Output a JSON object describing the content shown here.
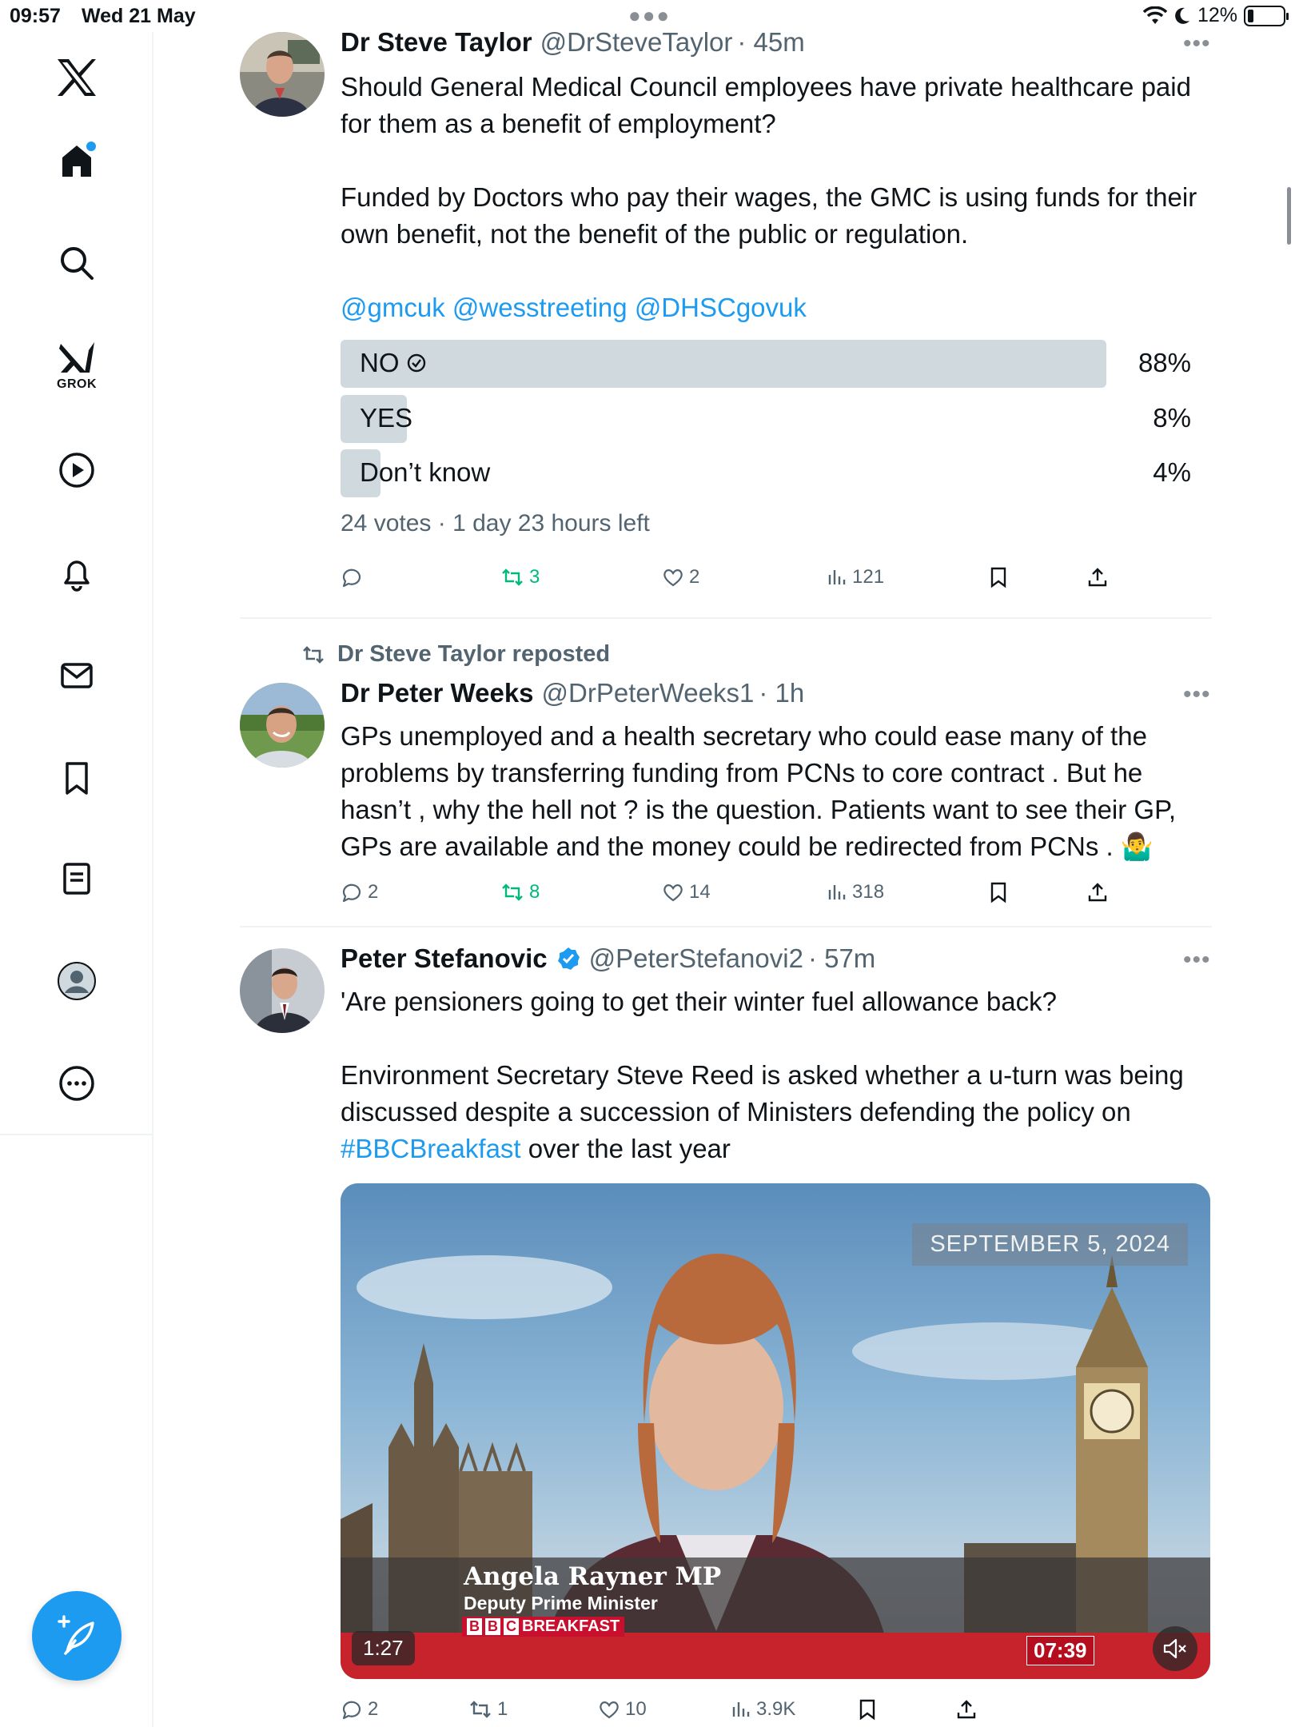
{
  "status_bar": {
    "time": "09:57",
    "date": "Wed 21 May",
    "battery": "12%"
  },
  "sidebar": {
    "items": [
      {
        "name": "home",
        "label": ""
      },
      {
        "name": "search",
        "label": ""
      },
      {
        "name": "grok",
        "label": "GROK"
      },
      {
        "name": "video",
        "label": ""
      },
      {
        "name": "notifications",
        "label": ""
      },
      {
        "name": "messages",
        "label": ""
      },
      {
        "name": "bookmarks",
        "label": ""
      },
      {
        "name": "lists",
        "label": ""
      },
      {
        "name": "profile",
        "label": ""
      },
      {
        "name": "more",
        "label": ""
      }
    ]
  },
  "tweets": [
    {
      "name": "Dr Steve Taylor",
      "handle": "@DrSteveTaylor",
      "time": "· 45m",
      "text1": "Should General Medical Council employees have private healthcare paid for them as a benefit of employment?",
      "text2": "Funded by Doctors who pay their wages, the GMC is using funds for their own benefit, not the benefit of the public or regulation.",
      "mentions": [
        "@gmcuk",
        "@wesstreeting",
        "@DHSCgovuk"
      ],
      "poll": {
        "options": [
          {
            "label": "NO",
            "pct": "88%",
            "value": 88,
            "winner": true
          },
          {
            "label": "YES",
            "pct": "8%",
            "value": 8,
            "winner": false
          },
          {
            "label": "Don’t know",
            "pct": "4%",
            "value": 4,
            "winner": false
          }
        ],
        "meta": "24 votes · 1 day 23 hours left"
      },
      "actions": {
        "replies": "",
        "reposts": "3",
        "likes": "2",
        "views": "121"
      }
    },
    {
      "repost_by": "Dr Steve Taylor reposted",
      "name": "Dr Peter Weeks",
      "handle": "@DrPeterWeeks1",
      "time": "· 1h",
      "text": "GPs unemployed and a health secretary who could ease many of the problems by transferring funding from PCNs to core contract . But he hasn’t , why the hell not ? is the question. Patients want to see their GP, GPs are available and the money could be redirected from PCNs . 🤷‍♂️",
      "actions": {
        "replies": "2",
        "reposts": "8",
        "likes": "14",
        "views": "318"
      }
    },
    {
      "name": "Peter Stefanovic",
      "handle": "@PeterStefanovi2",
      "time": "· 57m",
      "text1": "'Are pensioners going to get their winter fuel allowance back?",
      "text2": "Environment Secretary Steve Reed is asked whether a u-turn was being discussed despite a succession of Ministers defending the policy on",
      "hashtag": "#BBCBreakfast",
      "text3": " over the last year",
      "video": {
        "date_badge": "SEPTEMBER 5, 2024",
        "lower_third_name": "Angela Rayner MP",
        "lower_third_title": "Deputy Prime Minister",
        "bbc_letters": [
          "B",
          "B",
          "C"
        ],
        "programme": "BREAKFAST",
        "duration": "1:27",
        "clock": "07:39"
      },
      "actions": {
        "replies": "2",
        "reposts": "1",
        "likes": "10",
        "views": "3.9K"
      }
    }
  ],
  "colors": {
    "accent": "#1d9bf0",
    "repost_green": "#00ba7c",
    "muted": "#536471",
    "poll_bar": "#cfd9de"
  }
}
